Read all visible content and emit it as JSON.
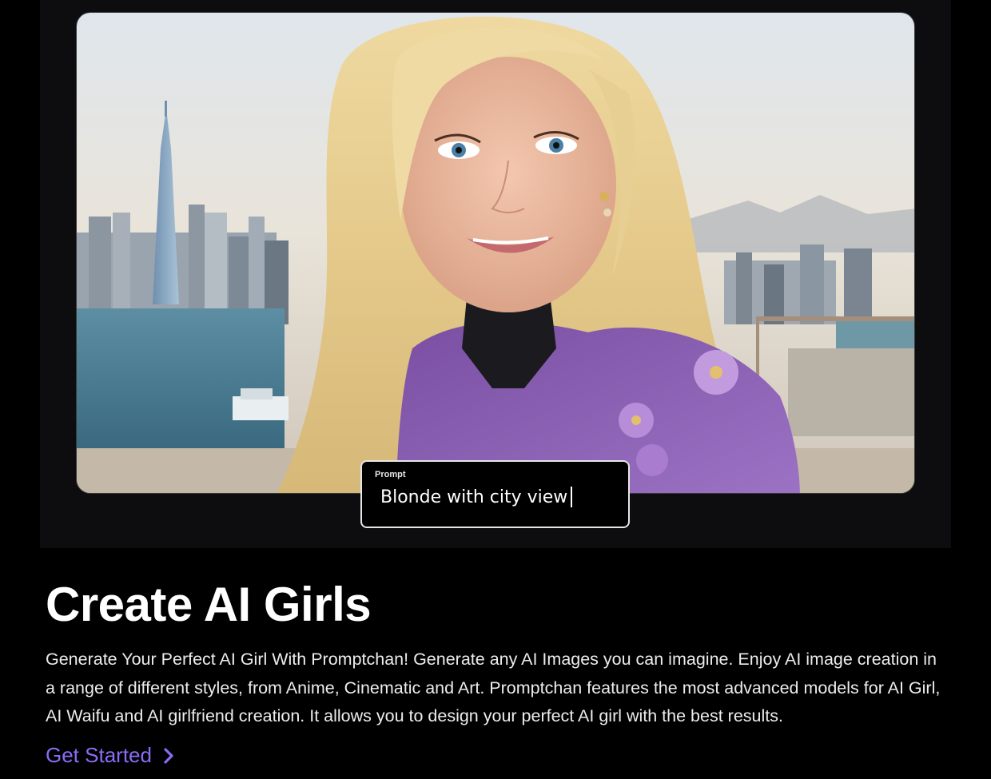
{
  "hero": {
    "image_alt": "Blonde woman smiling with a city skyline and waterfront behind her",
    "prompt_label": "Prompt",
    "prompt_value": "Blonde with city view"
  },
  "content": {
    "title": "Create AI Girls",
    "description": "Generate Your Perfect AI Girl With Promptchan! Generate any AI Images you can imagine. Enjoy AI image creation in a range of different styles, from Anime, Cinematic and Art. Promptchan features the most advanced models for AI Girl, AI Waifu and AI girlfriend creation. It allows you to design your perfect AI girl with the best results.",
    "cta_label": "Get Started",
    "cta_icon": "chevron-right-icon"
  },
  "colors": {
    "background": "#000000",
    "accent": "#8b6cf6",
    "text": "#ffffff"
  }
}
